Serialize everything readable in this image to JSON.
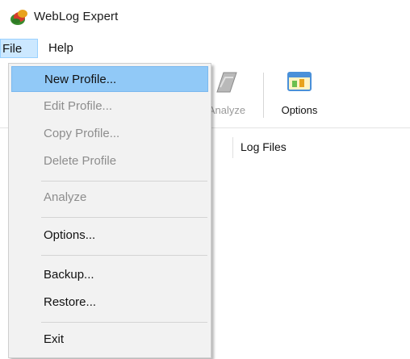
{
  "window": {
    "title": "WebLog Expert",
    "icon": "weblog-expert-app-icon"
  },
  "menubar": {
    "file": "File",
    "help": "Help"
  },
  "toolbar": {
    "analyze_label": "Analyze",
    "options_label": "Options"
  },
  "main": {
    "column_header": "Log Files"
  },
  "file_menu": {
    "items": [
      {
        "label": "New Profile...",
        "enabled": true,
        "highlighted": true
      },
      {
        "label": "Edit Profile...",
        "enabled": false
      },
      {
        "label": "Copy Profile...",
        "enabled": false
      },
      {
        "label": "Delete Profile",
        "enabled": false
      },
      {
        "label": "Analyze",
        "enabled": false
      },
      {
        "label": "Options...",
        "enabled": true
      },
      {
        "label": "Backup...",
        "enabled": true
      },
      {
        "label": "Restore...",
        "enabled": true
      },
      {
        "label": "Exit",
        "enabled": true
      }
    ]
  },
  "colors": {
    "menu_highlight": "#91c9f7",
    "menu_bg": "#f2f2f2",
    "active_menu_bg": "#cce8ff",
    "disabled_text": "#8d8d8d"
  }
}
